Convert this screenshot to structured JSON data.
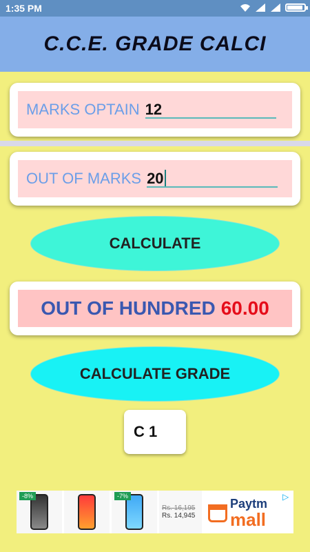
{
  "status_bar": {
    "time": "1:35 PM"
  },
  "app": {
    "title": "C.C.E. GRADE CALCI"
  },
  "marks": {
    "label": "MARKS OPTAIN",
    "value": "12"
  },
  "out_of": {
    "label": "OUT OF MARKS",
    "value": "20"
  },
  "buttons": {
    "calculate": "CALCULATE",
    "calculate_grade": "CALCULATE GRADE"
  },
  "result": {
    "label": "OUT OF HUNDRED",
    "value": "60.00"
  },
  "grade": {
    "value": "C 1"
  },
  "ad": {
    "discounts": [
      "-8%",
      "-7%"
    ],
    "old_price": "Rs. 16,195",
    "new_price": "Rs. 14,945",
    "brand_top": "Paytm",
    "brand_bottom": "mall",
    "colors": {
      "paytm_blue": "#00b9f1",
      "mall_orange": "#f26d21"
    }
  },
  "colors": {
    "background": "#f2ef7e",
    "app_bar": "#84aee8",
    "status_bar": "#5f8fc2",
    "result_value": "#e50d1a"
  }
}
